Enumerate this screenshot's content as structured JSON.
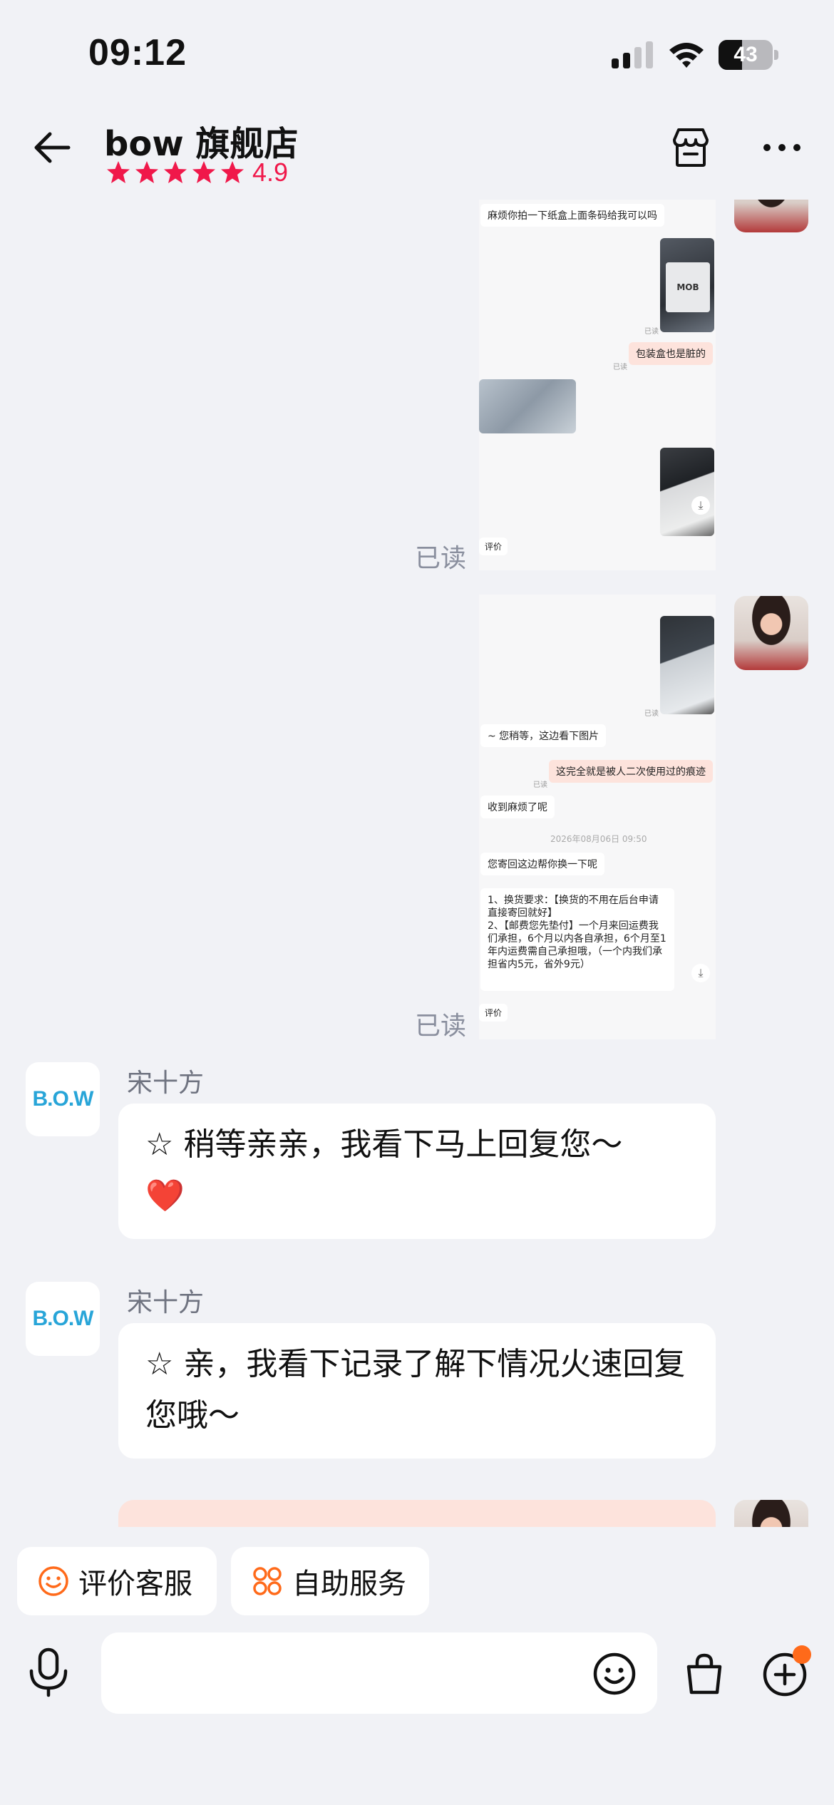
{
  "status": {
    "time": "09:12",
    "battery": "43",
    "battery_level_percent": 43
  },
  "header": {
    "title": "bow 旗舰店",
    "rating": "4.9",
    "stars": 5
  },
  "screenshot1": {
    "b1": "麻烦你拍一下纸盒上面条码给我可以吗",
    "img_text": "MOB",
    "read1": "已读",
    "b2": "包装盒也是脏的",
    "read2": "已读",
    "eval": "评价",
    "dl": "⤓"
  },
  "read_label_1": "已读",
  "screenshot2": {
    "read1": "已读",
    "b1": "~ 您稍等，这边看下图片",
    "b2": "这完全就是被人二次使用过的痕迹",
    "read2": "已读",
    "b3": "收到麻烦了呢",
    "time": "2026年08月06日 09:50",
    "b4": "您寄回这边帮你换一下呢",
    "long": "1、换货要求：【换货的不用在后台申请直接寄回就好】\n2、【邮费您先垫付】一个月来回运费我们承担，6个月以内各自承担，6个月至1年内运费需自己承担哦，（一个内我们承担省内5元，省外9元）",
    "eval": "评价",
    "dl": "⤓"
  },
  "read_label_2": "已读",
  "messages": [
    {
      "sender": "宋十方",
      "avatar": "B.O.W",
      "text": "☆ 稍等亲亲，我看下马上回复您～",
      "emoji": "❤️"
    },
    {
      "sender": "宋十方",
      "avatar": "B.O.W",
      "text": "☆ 亲，我看下记录了解下情况火速回复您哦～"
    }
  ],
  "quick_actions": [
    {
      "label": "评价客服",
      "icon": "smile-icon"
    },
    {
      "label": "自助服务",
      "icon": "grid-flower-icon"
    }
  ],
  "input": {
    "placeholder": ""
  },
  "colors": {
    "accent": "#f0184a",
    "orange": "#ff6a1a",
    "pink_bubble": "#fde3dc",
    "logo_blue": "#28a5d8"
  }
}
